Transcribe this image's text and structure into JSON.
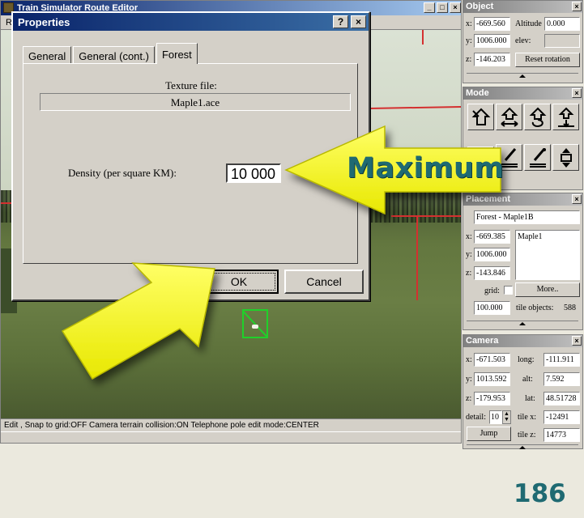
{
  "editor": {
    "title": "Train Simulator Route Editor",
    "menu_initial": "R",
    "window_buttons": [
      "_",
      "□",
      "×"
    ],
    "status": "Edit , Snap to grid:OFF Camera terrain collision:ON Telephone pole edit mode:CENTER"
  },
  "dialog": {
    "title": "Properties",
    "help_button": "?",
    "close_button": "×",
    "tabs": [
      "General",
      "General (cont.)",
      "Forest"
    ],
    "active_tab": "Forest",
    "texture_label": "Texture file:",
    "texture_value": "Maple1.ace",
    "density_label": "Density (per square KM):",
    "density_value": "10 000",
    "ok_label": "OK",
    "cancel_label": "Cancel"
  },
  "object_panel": {
    "title": "Object",
    "close": "×",
    "x_label": "x:",
    "x_value": "-669.560",
    "y_label": "y:",
    "y_value": "1006.000",
    "z_label": "z:",
    "z_value": "-146.203",
    "altitude_label": "Altitude",
    "altitude_value": "0.000",
    "elev_label": "elev:",
    "reset_label": "Reset rotation"
  },
  "mode_panel": {
    "title": "Mode",
    "close": "×",
    "tools": [
      "place-object",
      "move-object",
      "rotate-object",
      "raise-object",
      "select-tool",
      "brush-tool",
      "eyedropper-tool",
      "elevate-tool"
    ]
  },
  "placement_panel": {
    "title": "Placement",
    "close": "×",
    "object_name": "Forest - Maple1B",
    "x_label": "x:",
    "x_value": "-669.385",
    "y_label": "y:",
    "y_value": "1006.000",
    "z_label": "z:",
    "z_value": "-143.846",
    "list_item": "Maple1",
    "grid_label": "grid:",
    "more_label": "More..",
    "grid_value": "100.000",
    "tile_objects_label": "tile objects:",
    "tile_objects_value": "588"
  },
  "camera_panel": {
    "title": "Camera",
    "close": "×",
    "x_label": "x:",
    "x_value": "-671.503",
    "y_label": "y:",
    "y_value": "1013.592",
    "z_label": "z:",
    "z_value": "-179.953",
    "long_label": "long:",
    "long_value": "-111.911",
    "alt_label": "alt:",
    "alt_value": "7.592",
    "lat_label": "lat:",
    "lat_value": "48.51728",
    "detail_label": "detail:",
    "detail_value": "10",
    "tilex_label": "tile x:",
    "tilex_value": "-12491",
    "tilez_label": "tile z:",
    "tilez_value": "14773",
    "jump_label": "Jump"
  },
  "annotations": {
    "callout_text": "Maximum",
    "page_number": "186",
    "arrow_color": "#ffff1a",
    "text_color": "#1f6a72"
  }
}
